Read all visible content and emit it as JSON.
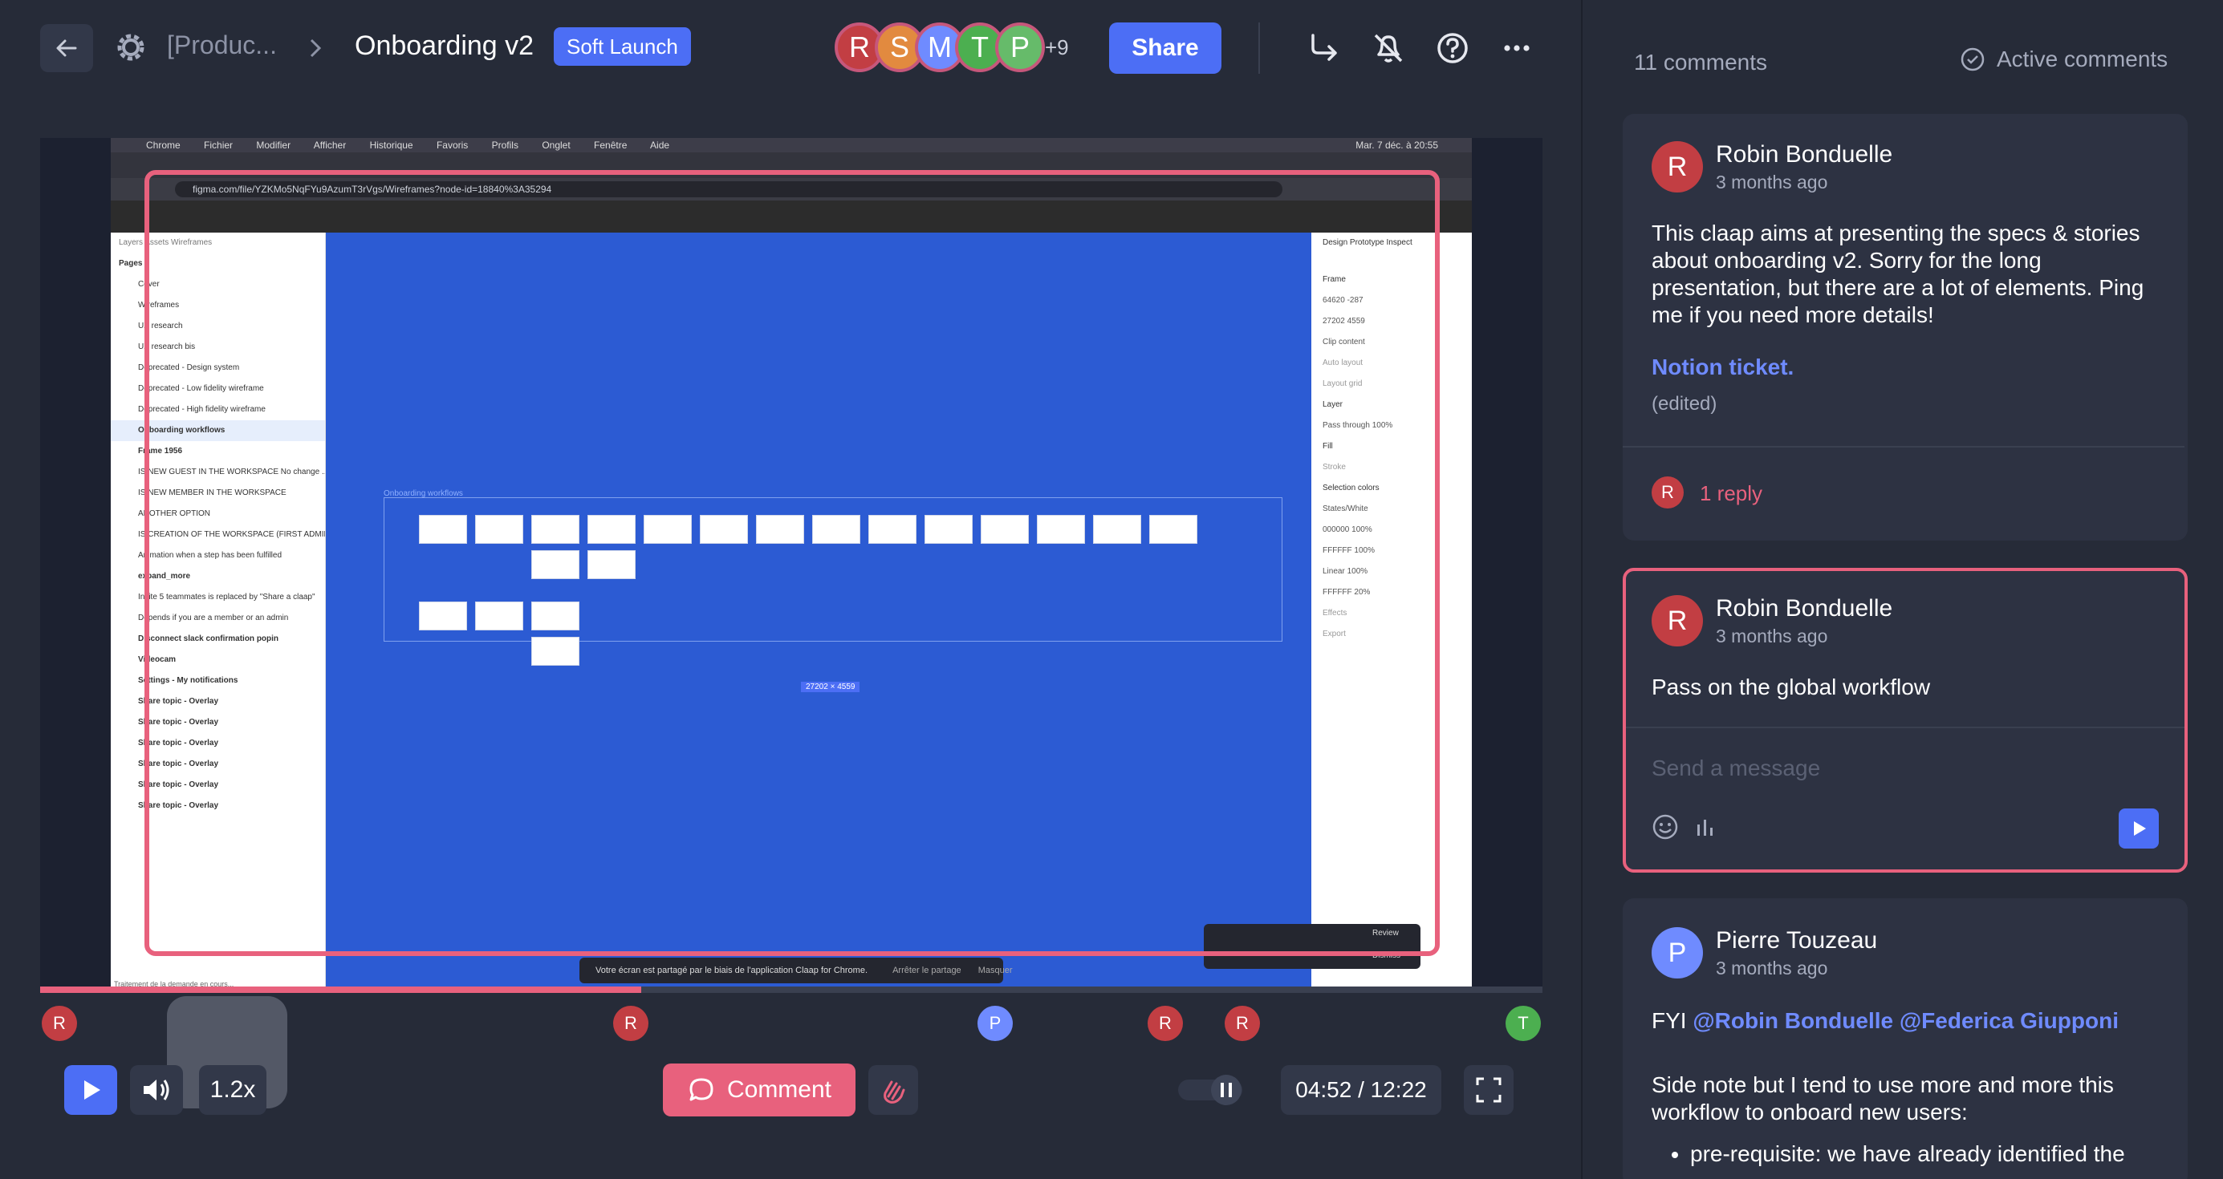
{
  "topbar": {
    "breadcrumb_workspace": "[Produc...",
    "title": "Onboarding v2",
    "tag": "Soft Launch",
    "participants": [
      {
        "initial": "R",
        "color": "#c23e43"
      },
      {
        "initial": "S",
        "color": "#e28a3f"
      },
      {
        "initial": "M",
        "color": "#6f8bff"
      },
      {
        "initial": "T",
        "color": "#4caf50"
      },
      {
        "initial": "P",
        "color": "#66bb6a"
      }
    ],
    "participants_more": "+9",
    "share_label": "Share"
  },
  "screen": {
    "menu_items": [
      "Chrome",
      "Fichier",
      "Modifier",
      "Afficher",
      "Historique",
      "Favoris",
      "Profils",
      "Onglet",
      "Fenêtre",
      "Aide"
    ],
    "datetime": "Mar. 7 déc. à 20:55",
    "url": "figma.com/file/YZKMo5NqFYu9AzumT3rVgs/Wireframes?node-id=18840%3A35294",
    "layers_tabs": "Layers   Assets   Wireframes",
    "layers": [
      "Pages",
      "Cover",
      "Wireframes",
      "UX research",
      "UX research bis",
      "Deprecated - Design system",
      "Deprecated - Low fidelity wireframe",
      "Deprecated - High fidelity wireframe",
      "Onboarding workflows",
      "Frame 1956",
      "IS NEW GUEST IN THE WORKSPACE No change ...",
      "IS NEW MEMBER IN THE WORKSPACE",
      "ANOTHER OPTION",
      "IS CREATION OF THE WORKSPACE (FIRST ADMIN...",
      "Animation when a step has been fulfilled",
      "expand_more",
      "Invite 5 teammates is replaced by \"Share a claap\"",
      "Depends if you are a member or an admin",
      "Disconnect slack confirmation popin",
      "Videocam",
      "Settings - My notifications",
      "Share topic - Overlay",
      "Share topic - Overlay",
      "Share topic - Overlay",
      "Share topic - Overlay",
      "Share topic - Overlay",
      "Share topic - Overlay"
    ],
    "canvas_label": "Onboarding workflows",
    "canvas_size": "27202 × 4559",
    "right_panel": [
      "Design   Prototype   Inspect",
      "Frame",
      "64620    -287",
      "27202    4559",
      "Clip content",
      "Auto layout",
      "Layout grid",
      "Layer",
      "Pass through    100%",
      "Fill",
      "Stroke",
      "Selection colors",
      "States/White",
      "000000    100%",
      "FFFFFF    100%",
      "Linear    100%",
      "FFFFFF    20%",
      "Effects",
      "Export"
    ],
    "share_banner": "Votre écran est partagé par le biais de l'application Claap for Chrome.",
    "share_banner_stop": "Arrêter le partage",
    "share_banner_hide": "Masquer",
    "notif_review": "Review",
    "notif_dismiss": "Dismiss",
    "status_text": "Traitement de la demande en cours..."
  },
  "player": {
    "progress": 0.4,
    "markers": [
      {
        "initial": "R",
        "color": "#c23e43"
      },
      {
        "initial": "R",
        "color": "#c23e43"
      },
      {
        "initial": "P",
        "color": "#6f8bff"
      },
      {
        "initial": "R",
        "color": "#c23e43"
      },
      {
        "initial": "R",
        "color": "#c23e43"
      },
      {
        "initial": "T",
        "color": "#4caf50"
      }
    ],
    "speed": "1.2x",
    "comment_label": "Comment",
    "time": "04:52 / 12:22"
  },
  "comments_panel": {
    "count": "11 comments",
    "active_label": "Active comments",
    "comments": [
      {
        "author": "Robin Bonduelle",
        "initial": "R",
        "avatar_color": "#c23e43",
        "time": "3 months ago",
        "body": "This claap aims at presenting the specs & stories about onboarding v2. Sorry for the long presentation, but there are a lot of elements. Ping me if you need more details!",
        "link": "Notion ticket.",
        "edited": "(edited)",
        "reply_initial": "R",
        "replies": "1 reply"
      },
      {
        "author": "Robin Bonduelle",
        "initial": "R",
        "avatar_color": "#c23e43",
        "time": "3 months ago",
        "body": "Pass on the global workflow",
        "input_placeholder": "Send a message"
      },
      {
        "author": "Pierre Touzeau",
        "initial": "P",
        "avatar_color": "#6f8bff",
        "time": "3 months ago",
        "fyi": "FYI",
        "mention1": "@Robin Bonduelle",
        "mention2": "@Federica Giupponi",
        "body": "Side note but I tend to use more and more this workflow to onboard new users:",
        "bullet": "pre-requisite: we have already identified the"
      }
    ]
  }
}
